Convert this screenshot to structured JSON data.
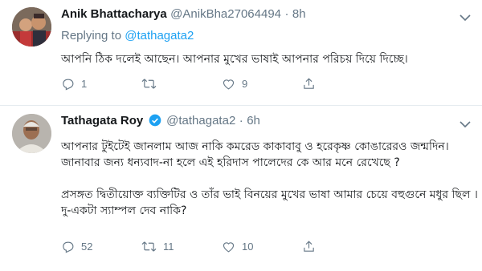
{
  "tweets": [
    {
      "name": "Anik Bhattacharya",
      "handle": "@AnikBha27064494",
      "separator": "·",
      "time": "8h",
      "replying_label": "Replying to ",
      "replying_to": "@tathagata2",
      "text": "আপনি ঠিক দলেই আছেন। আপনার মুখের ভাষাই আপনার পরিচয় দিয়ে দিচ্ছে।",
      "counts": {
        "reply": "1",
        "retweet": "",
        "like": "9"
      }
    },
    {
      "name": "Tathagata Roy",
      "handle": "@tathagata2",
      "separator": "·",
      "time": "6h",
      "text": "আপনার টুইটেই জানলাম আজ নাকি কমরেড কাকাবাবু ও হরেকৃষ্ণ কোঙারেরও জন্মদিন।\nজানাবার জন্য ধন্যবাদ-না হলে এই হরিদাস পালেদের কে আর মনে রেখেছে ?\n\nপ্রসঙ্গত দ্বিতীয়োক্ত ব্যক্তিটির ও তাঁর ভাই বিনয়ের মুখের ভাষা আমার চেয়ে বহুগুনে মধুর ছিল ।\nদু-একটা স্যাম্পল দেব নাকি?",
      "counts": {
        "reply": "52",
        "retweet": "11",
        "like": "10"
      }
    }
  ],
  "colors": {
    "accent": "#1da1f2",
    "muted": "#657786",
    "text": "#14171a"
  },
  "icons": [
    "chevron-down-icon",
    "verified-badge-icon",
    "reply-icon",
    "retweet-icon",
    "like-icon",
    "share-icon"
  ]
}
